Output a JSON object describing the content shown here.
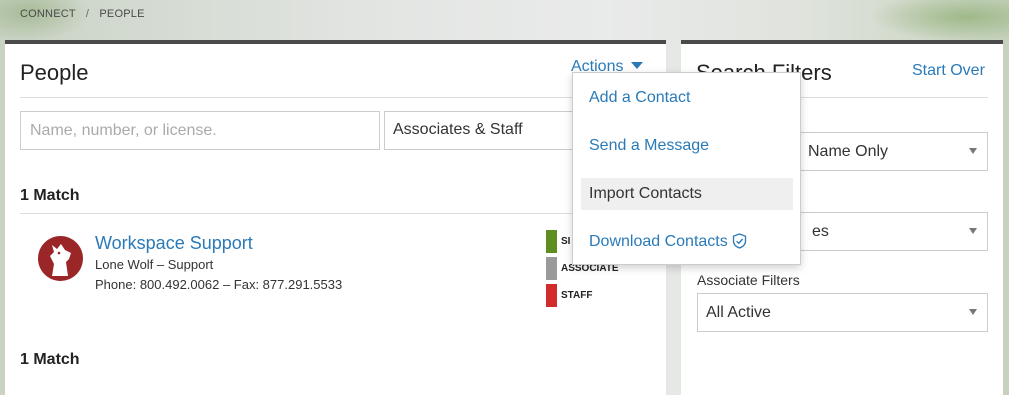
{
  "breadcrumb": {
    "root": "CONNECT",
    "separator": "/",
    "current": "PEOPLE"
  },
  "people_panel": {
    "title": "People",
    "actions_label": "Actions",
    "search": {
      "placeholder": "Name, number, or license.",
      "value": ""
    },
    "type_filter": {
      "selected": "Associates & Staff"
    },
    "match_count_top": "1 Match",
    "match_count_bottom": "1 Match",
    "contact": {
      "name": "Workspace Support",
      "company": "Lone Wolf – Support",
      "phone_line": "Phone: 800.492.0062 – Fax: 877.291.5533",
      "avatar_icon": "wolf-logo-icon",
      "tags": [
        {
          "label": "SI",
          "color": "#5e8e1f"
        },
        {
          "label": "ASSOCIATE",
          "color": "#9a9a9a"
        },
        {
          "label": "STAFF",
          "color": "#d22b2b"
        }
      ]
    }
  },
  "actions_menu": {
    "items": [
      {
        "label": "Add a Contact"
      },
      {
        "label": "Send a Message"
      },
      {
        "label": "Import Contacts",
        "highlighted": true
      },
      {
        "label": "Download Contacts",
        "icon": "shield-check-icon"
      }
    ]
  },
  "filters_panel": {
    "title": "Search Filters",
    "start_over": "Start Over",
    "select_1_visible_text": "Name Only",
    "select_2_visible_text": "es",
    "associate_filters_label": "Associate Filters",
    "associate_filters_value": "All Active"
  },
  "colors": {
    "link": "#2a7ab8",
    "panel_border": "#4a4a4a",
    "avatar_bg": "#9b2628"
  }
}
